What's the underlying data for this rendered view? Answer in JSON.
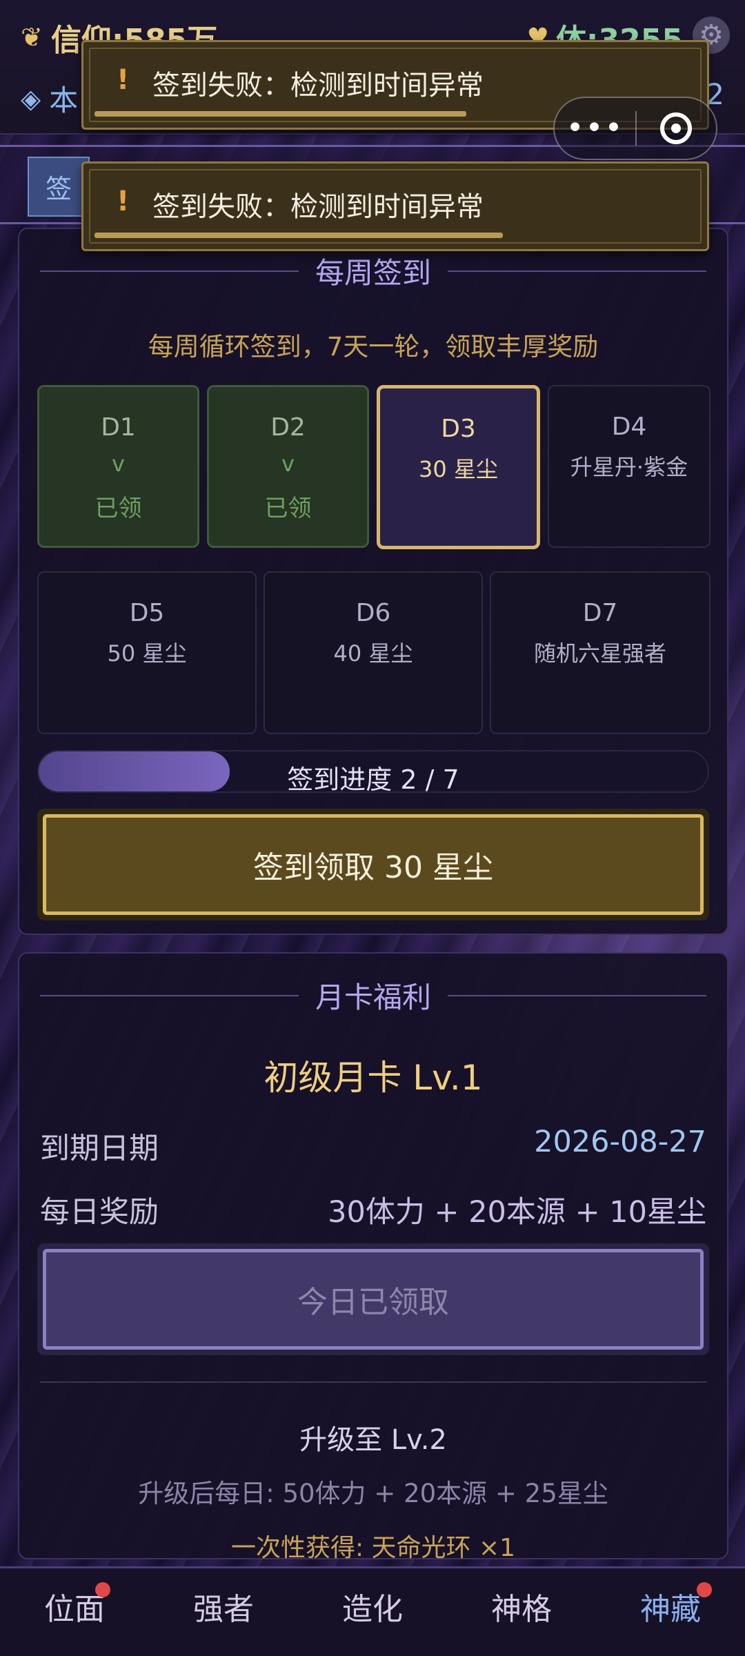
{
  "header": {
    "faith_icon": "wheat-icon",
    "faith_text": "信仰:585万",
    "stamina_icon": "heart-icon",
    "stamina_text": "体:3255",
    "source_icon": "diamond-icon",
    "source_text": "本",
    "source_right": "2"
  },
  "tabs": {
    "active_tab": "签"
  },
  "capsule": {
    "more_label": "•••",
    "close_icon": "target-icon"
  },
  "toasts": [
    {
      "icon": "!",
      "message": "签到失败：检测到时间异常",
      "progress": 0.62
    },
    {
      "icon": "!",
      "message": "签到失败：检测到时间异常",
      "progress": 0.68
    }
  ],
  "weekly": {
    "title": "每周签到",
    "subtitle": "每周循环签到，7天一轮，领取丰厚奖励",
    "days": [
      {
        "day": "D1",
        "reward": "v",
        "status": "已领"
      },
      {
        "day": "D2",
        "reward": "v",
        "status": "已领"
      },
      {
        "day": "D3",
        "reward": "30 星尘",
        "status": ""
      },
      {
        "day": "D4",
        "reward": "升星丹·紫金",
        "status": ""
      },
      {
        "day": "D5",
        "reward": "50 星尘",
        "status": ""
      },
      {
        "day": "D6",
        "reward": "40 星尘",
        "status": ""
      },
      {
        "day": "D7",
        "reward": "随机六星强者",
        "status": ""
      }
    ],
    "progress_label": "签到进度  2 / 7",
    "progress_value": 0.286,
    "claim_button": "签到领取  30 星尘"
  },
  "monthly": {
    "title": "月卡福利",
    "card_name": "初级月卡 Lv.1",
    "expiry_label": "到期日期",
    "expiry_value": "2026-08-27",
    "daily_label": "每日奖励",
    "daily_value": "30体力 + 20本源 + 10星尘",
    "claimed_button": "今日已领取",
    "upgrade_title": "升级至 Lv.2",
    "upgrade_desc": "升级后每日: 50体力 + 20本源 + 25星尘",
    "upgrade_bonus": "一次性获得: 天命光环 ×1"
  },
  "nav": {
    "items": [
      {
        "label": "位面",
        "badge": true,
        "active": false
      },
      {
        "label": "强者",
        "badge": false,
        "active": false
      },
      {
        "label": "造化",
        "badge": false,
        "active": false
      },
      {
        "label": "神格",
        "badge": false,
        "active": false
      },
      {
        "label": "神藏",
        "badge": true,
        "active": true
      }
    ]
  },
  "colors": {
    "gold_accent": "#d9b860",
    "purple_accent": "#7a66be",
    "claimed_green": "#6fa060",
    "badge_red": "#e04848",
    "active_nav": "#8ab0ee"
  }
}
